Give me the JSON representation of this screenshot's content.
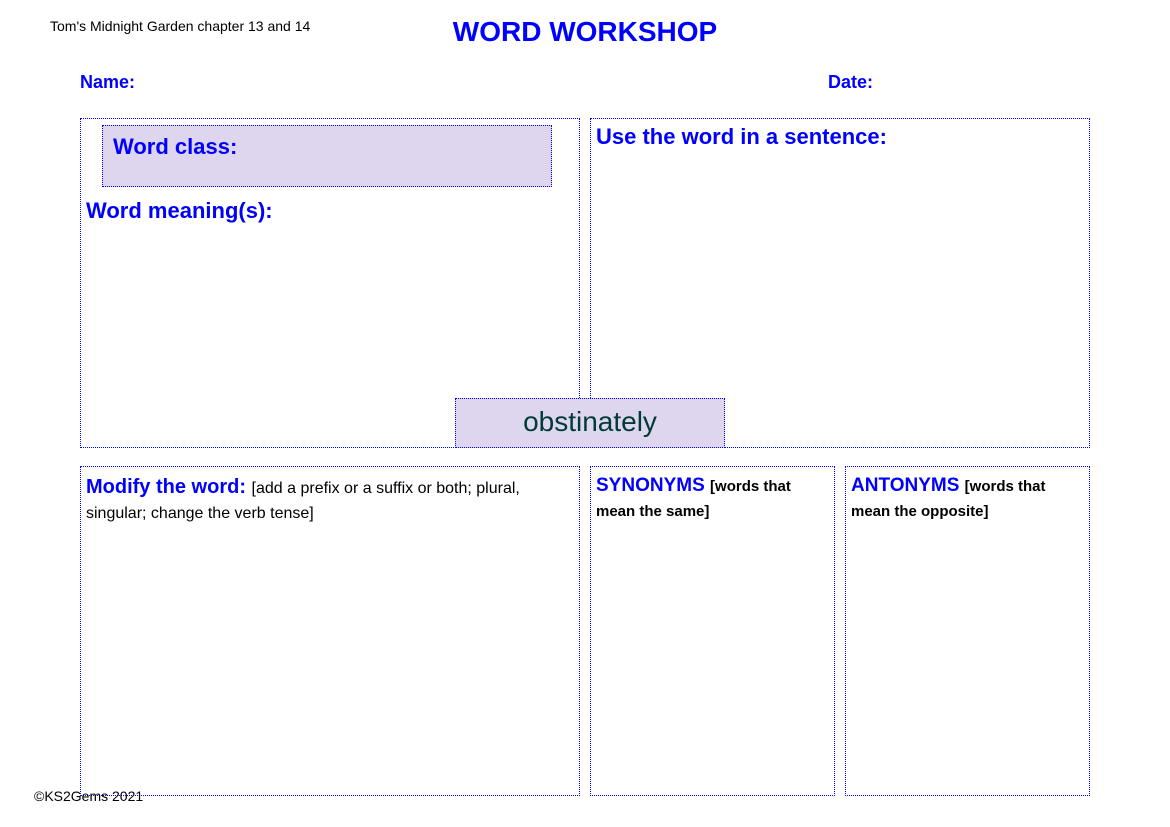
{
  "chapter": "Tom's Midnight Garden chapter 13 and 14",
  "title": "WORD WORKSHOP",
  "labels": {
    "name": "Name:",
    "date": "Date:",
    "word_class": "Word class:",
    "word_meaning": "Word meaning(s):",
    "sentence": "Use the word in a sentence:",
    "modify_lead": "Modify the word:  ",
    "modify_sub": "[add a prefix or a suffix or both; plural, singular; change the verb tense]",
    "synonyms_lead": "SYNONYMS ",
    "synonyms_sub": "[words that mean the same]",
    "antonyms_lead": "ANTONYMS ",
    "antonyms_sub": "[words that mean the opposite]"
  },
  "center_word": "obstinately",
  "copyright": "©KS2Gems 2021"
}
